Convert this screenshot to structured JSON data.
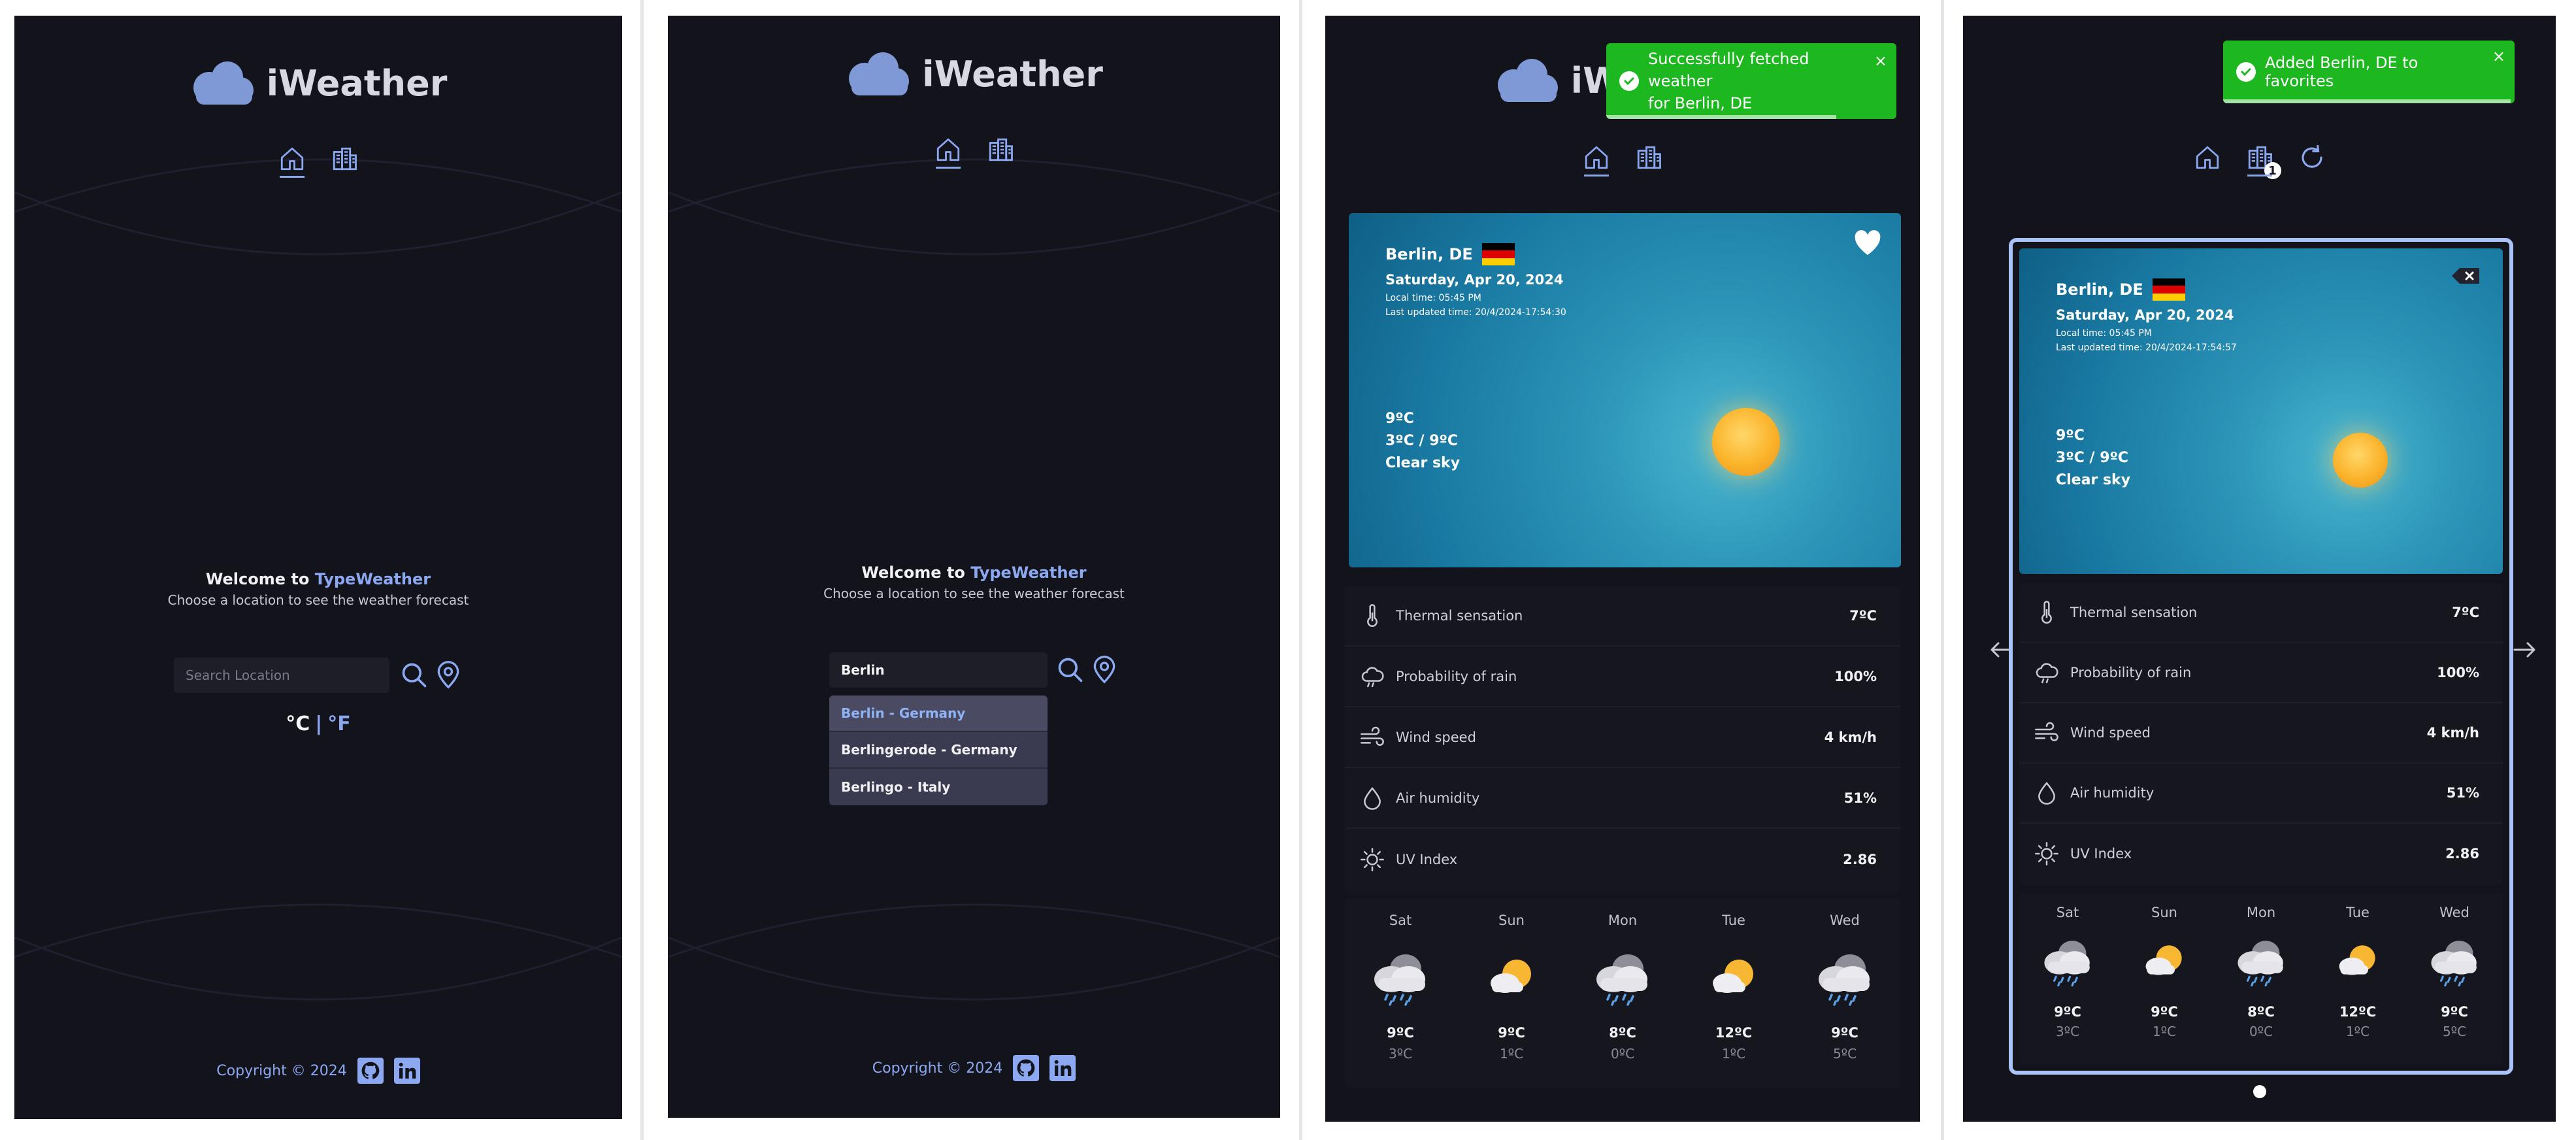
{
  "app": {
    "name": "iWeather"
  },
  "welcome": {
    "prefix": "Welcome to ",
    "brand": "TypeWeather",
    "subtitle": "Choose a location to see the weather forecast"
  },
  "search": {
    "placeholder": "Search Location",
    "value": "Berlin"
  },
  "units": {
    "c": "°C",
    "sep": "|",
    "f": "°F"
  },
  "suggestions": [
    "Berlin - Germany",
    "Berlingerode - Germany",
    "Berlingo - Italy"
  ],
  "footer": {
    "copyright": "Copyright © 2024"
  },
  "toasts": {
    "fetched": "Successfully fetched weather for Berlin, DE",
    "fetched_line1": "Successfully fetched weather",
    "fetched_line2": "for Berlin, DE",
    "favorite": "Added Berlin, DE to favorites",
    "close": "×"
  },
  "favorites_badge": "1",
  "weather": {
    "city": "Berlin, DE",
    "date": "Saturday, Apr 20, 2024",
    "local_time": "Local time: 05:45 PM",
    "updated_p3": "Last updated time: 20/4/2024-17:54:30",
    "updated_p4": "Last updated time: 20/4/2024-17:54:57",
    "temp": "9ºC",
    "range": "3ºC / 9ºC",
    "condition": "Clear sky"
  },
  "details": [
    {
      "label": "Thermal sensation",
      "value": "7ºC",
      "icon": "thermometer-icon"
    },
    {
      "label": "Probability of rain",
      "value": "100%",
      "icon": "rain-cloud-icon"
    },
    {
      "label": "Wind speed",
      "value": "4 km/h",
      "icon": "wind-icon"
    },
    {
      "label": "Air humidity",
      "value": "51%",
      "icon": "droplet-icon"
    },
    {
      "label": "UV Index",
      "value": "2.86",
      "icon": "sun-icon"
    }
  ],
  "forecast": [
    {
      "day": "Sat",
      "hi": "9ºC",
      "lo": "3ºC",
      "icon": "rain-cloud-icon"
    },
    {
      "day": "Sun",
      "hi": "9ºC",
      "lo": "1ºC",
      "icon": "partly-cloudy-icon"
    },
    {
      "day": "Mon",
      "hi": "8ºC",
      "lo": "0ºC",
      "icon": "rain-cloud-icon"
    },
    {
      "day": "Tue",
      "hi": "12ºC",
      "lo": "1ºC",
      "icon": "partly-cloudy-icon"
    },
    {
      "day": "Wed",
      "hi": "9ºC",
      "lo": "5ºC",
      "icon": "rain-cloud-icon"
    }
  ],
  "colors": {
    "background": "#13131b",
    "accent": "#8ba8f0",
    "toast": "#1db820",
    "card": "#1877a0",
    "highlight": "#a9c3f7"
  }
}
